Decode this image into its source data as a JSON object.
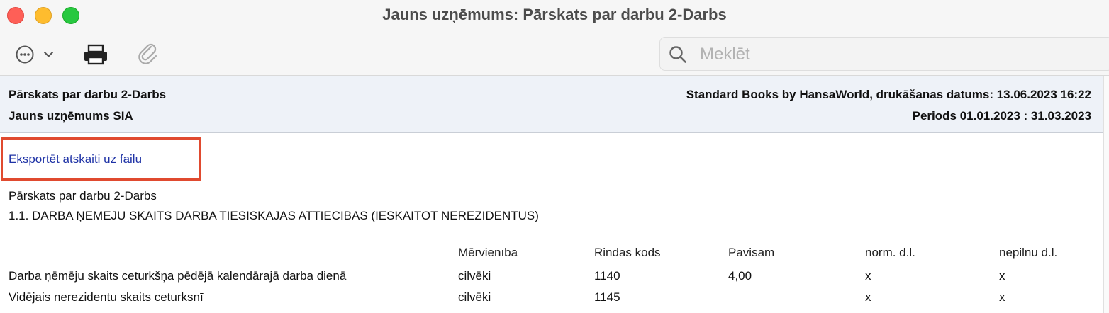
{
  "window": {
    "title": "Jauns uzņēmums: Pārskats par darbu 2-Darbs"
  },
  "toolbar": {
    "more_icon": "ellipsis-circle-icon",
    "print_icon": "printer-icon",
    "attach_icon": "paperclip-icon",
    "search_placeholder": "Meklēt",
    "search_value": ""
  },
  "report_header": {
    "title": "Pārskats par darbu 2-Darbs",
    "company": "Jauns uzņēmums SIA",
    "source_and_print_date": "Standard Books by HansaWorld, drukāšanas datums: 13.06.2023 16:22",
    "period": "Periods  01.01.2023 : 31.03.2023"
  },
  "export": {
    "label": "Eksportēt atskaiti uz failu"
  },
  "report": {
    "title": "Pārskats par darbu 2-Darbs",
    "section_heading": "1.1. DARBA ŅĒMĒJU SKAITS DARBA TIESISKAJĀS ATTIECĪBĀS (IESKAITOT NEREZIDENTUS)",
    "columns": [
      "Mērvienība",
      "Rindas kods",
      "Pavisam",
      "norm. d.l.",
      "nepilnu d.l."
    ],
    "rows": [
      [
        "Darba ņēmēju skaits ceturkšņa pēdējā kalendārajā darba dienā",
        "cilvēki",
        "1140",
        "4,00",
        "x",
        "x"
      ],
      [
        "Vidējais nerezidentu skaits ceturksnī",
        "cilvēki",
        "1145",
        "",
        "x",
        "x"
      ]
    ]
  },
  "colors": {
    "highlight_border": "#e04a2f",
    "link": "#1f33a6",
    "header_band": "#eef2f8"
  }
}
